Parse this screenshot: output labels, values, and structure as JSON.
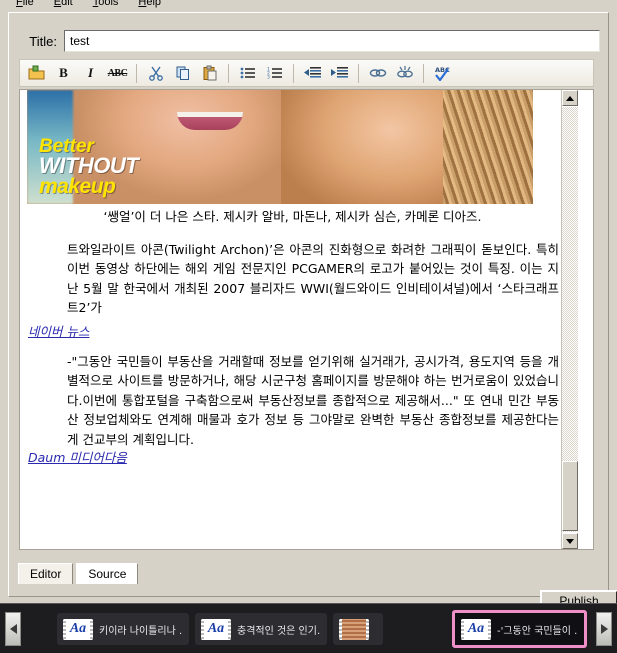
{
  "menubar": {
    "items": [
      {
        "label": "File",
        "mnemonic": "F",
        "rest": "ile"
      },
      {
        "label": "Edit",
        "mnemonic": "E",
        "rest": "dit"
      },
      {
        "label": "Tools",
        "mnemonic": "T",
        "rest": "ools"
      },
      {
        "label": "Help",
        "mnemonic": "H",
        "rest": "elp"
      }
    ]
  },
  "title_field": {
    "label": "Title:",
    "value": "test",
    "placeholder": ""
  },
  "toolbar": {
    "buttons": [
      {
        "name": "new-document-icon",
        "glyph": "folder"
      },
      {
        "name": "bold-icon",
        "glyph": "B"
      },
      {
        "name": "italic-icon",
        "glyph": "I"
      },
      {
        "name": "strikethrough-icon",
        "glyph": "ABC"
      },
      {
        "name": "cut-icon",
        "glyph": "scissors"
      },
      {
        "name": "copy-icon",
        "glyph": "copy"
      },
      {
        "name": "paste-icon",
        "glyph": "clipboard"
      },
      {
        "name": "bullet-list-icon",
        "glyph": "ul"
      },
      {
        "name": "numbered-list-icon",
        "glyph": "ol"
      },
      {
        "name": "outdent-icon",
        "glyph": "outdent"
      },
      {
        "name": "indent-icon",
        "glyph": "indent"
      },
      {
        "name": "insert-link-icon",
        "glyph": "link"
      },
      {
        "name": "unlink-icon",
        "glyph": "unlink"
      },
      {
        "name": "spellcheck-icon",
        "glyph": "spell"
      }
    ]
  },
  "editor": {
    "image_caption_overlay": {
      "line1": "Better",
      "line2": "WITHOUT",
      "line3": "makeup"
    },
    "caption": "‘쌩얼’이 더 나은 스타. 제시카 알바, 마돈나, 제시카 심슨, 카메론 디아즈.",
    "paragraph1": "트와일라이트 아콘(Twilight Archon)’은 아콘의 진화형으로 화려한 그래픽이 돋보인다. 특히 이번 동영상 하단에는 해외 게임 전문지인 PCGAMER의 로고가 붙어있는 것이 특징. 이는 지난 5월 말 한국에서 개최된 2007 블리자드 WWI(월드와이드 인비테이셔널)에서 ‘스타크래프트2’가",
    "link1": "네이버 뉴스",
    "paragraph2": "-\"그동안 국민들이 부동산을 거래할때 정보를 얻기위해 실거래가, 공시가격, 용도지역 등을 개별적으로 사이트를 방문하거나, 해당 시군구청 홈페이지를 방문해야 하는 번거로움이 있었습니다.이번에 통합포털을 구축함으로써 부동산정보를 종합적으로 제공해서...\" 또 연내 민간 부동산 정보업체와도 연계해 매물과 호가 정보 등 그야말로 완벽한 부동산 종합정보를 제공한다는게 건교부의 계획입니다.",
    "link2": "Daum 미디어다음"
  },
  "tabs": [
    {
      "label": "Editor",
      "active": true
    },
    {
      "label": "Source",
      "active": false
    }
  ],
  "publish_button": {
    "label": "Publish"
  },
  "taskbar": {
    "scroll_left": "◀",
    "scroll_right": "▶",
    "items": [
      {
        "label": "키이라 나이틀리나 ...",
        "icon": "aa-text-icon",
        "selected": false
      },
      {
        "label": "충격적인 것은 인기...",
        "icon": "aa-text-icon",
        "selected": false
      },
      {
        "label": "",
        "icon": "photo-thumbnail-icon",
        "selected": false
      },
      {
        "label": "-'그동안 국민들이 ...",
        "icon": "aa-text-icon",
        "selected": true
      }
    ]
  },
  "colors": {
    "window_bg": "#d6d2c8",
    "editor_bg": "#ffffff",
    "link": "#2a2ab0",
    "taskbar_bg": "#1d1d20",
    "selection_highlight": "#ef8fc8"
  }
}
